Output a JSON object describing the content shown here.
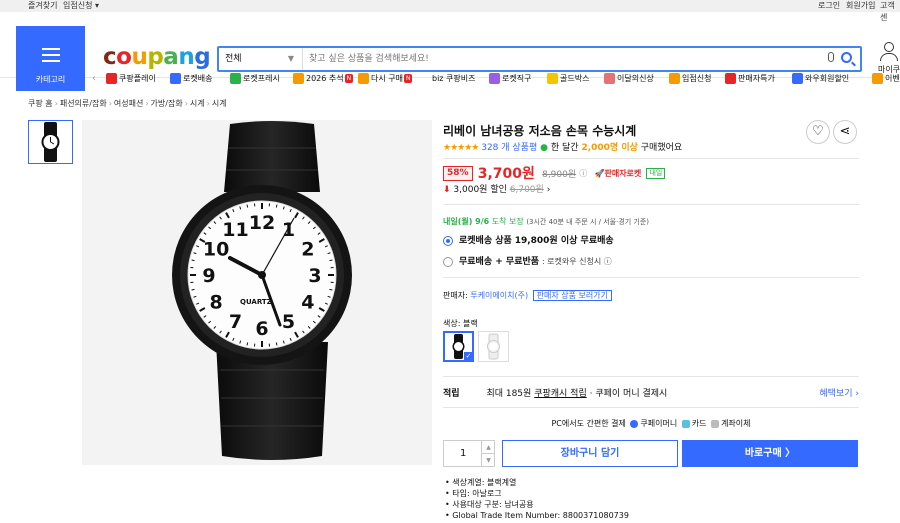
{
  "topbar": {
    "favorites": "즐겨찾기",
    "store_apply": "입점신청 ▾",
    "login": "로그인",
    "signup": "회원가입",
    "customer": "고객센"
  },
  "header": {
    "category_label": "카테고리",
    "logo_letters": [
      "c",
      "o",
      "u",
      "p",
      "a",
      "n",
      "g"
    ],
    "logo_colors": [
      "#7d2a16",
      "#e52528",
      "#f59b00",
      "#b6b600",
      "#4caf50",
      "#1fa0e0",
      "#2b6cdf"
    ],
    "search_category": "전체",
    "search_placeholder": "찾고 싶은 상품을 검색해보세요!",
    "mycoupang": "마이쿠"
  },
  "nav": [
    {
      "label": "쿠팡플레이",
      "color": "#e52528",
      "icon": "play-icon"
    },
    {
      "label": "로켓배송",
      "color": "#346aff",
      "icon": "rocket-icon"
    },
    {
      "label": "로켓프레시",
      "color": "#2bb14a",
      "icon": "fresh-rocket-icon"
    },
    {
      "label": "2026 추석",
      "color": "#f59b00",
      "icon": "chuseok-icon",
      "badge": "N"
    },
    {
      "label": "다시 구매",
      "color": "#f59b00",
      "icon": "rebuy-icon",
      "badge": "N"
    },
    {
      "label": "biz 쿠팡비즈",
      "color": "#fff",
      "icon": "biz-icon"
    },
    {
      "label": "로켓직구",
      "color": "#9b5de5",
      "icon": "global-icon"
    },
    {
      "label": "골드박스",
      "color": "#f5c400",
      "icon": "goldbox-icon"
    },
    {
      "label": "이달의신상",
      "color": "#e57373",
      "icon": "new-icon"
    },
    {
      "label": "입점신청",
      "color": "#f59b00",
      "icon": "store-icon"
    },
    {
      "label": "판매자특가",
      "color": "#e52528",
      "icon": "sale-icon"
    },
    {
      "label": "와우회원할인",
      "color": "#346aff",
      "icon": "wow-icon"
    },
    {
      "label": "이벤트",
      "color": "#f59b00",
      "icon": "event-icon"
    }
  ],
  "breadcrumb": [
    "쿠팡 홈",
    "패션의류/잡화",
    "여성패션",
    "가방/잡화",
    "시계",
    "시계"
  ],
  "product": {
    "title": "리베이 남녀공용 저소음 손목 수능시계",
    "stars": "★★★★★",
    "review_count": "328 개 상품평",
    "monthly_prefix": "한 달간",
    "monthly_count": "2,000명 이상",
    "monthly_suffix": "구매했어요",
    "discount": "58%",
    "price": "3,700원",
    "orig_price": "8,900원",
    "info_icon": "ⓘ",
    "rocket_seller": "🚀판매자로켓",
    "new_badge": "내일",
    "coupon_arrow": "⬇",
    "coupon": "3,000원 할인",
    "coupon_orig": "6,700원",
    "coupon_chevron": "›",
    "delivery_date": "내일(월) 9/6",
    "delivery_mid": "도착 보장",
    "delivery_note": "(3시간 40분 내 주문 시 / 서울·경기 기준)",
    "opt1_strong": "로켓배송 상품",
    "opt1_rest": "19,800원 이상 무료배송",
    "opt2_strong": "무료배송 + 무료반품",
    "opt2_rest": ": 로켓와우 신청시 ⓘ",
    "seller_label": "판매자:",
    "seller_name": "투케이에이치(주)",
    "seller_btn": "판매자 상품 보러가기",
    "color_label": "색상: 블랙",
    "points_label": "적립",
    "points_text": "최대 185원",
    "points_link": "쿠팡캐시 적립",
    "points_rest": "· 쿠페이 머니 결제시",
    "benefit": "혜택보기 ›",
    "pc_pay": "PC에서도 간편한 결제",
    "pay1": "쿠페이머니",
    "pay2": "카드",
    "pay3": "계좌이체",
    "qty": "1",
    "cart": "장바구니 담기",
    "buy": "바로구매 〉",
    "specs": [
      "색상계열: 블랙계열",
      "타입: 아날로그",
      "사용대상 구분: 남녀공용",
      "Global Trade Item Number: 8800371080739"
    ]
  },
  "watch": {
    "brand": "QUARTZ",
    "numerals": [
      "12",
      "1",
      "2",
      "3",
      "4",
      "5",
      "6",
      "7",
      "8",
      "9",
      "10",
      "11"
    ]
  }
}
